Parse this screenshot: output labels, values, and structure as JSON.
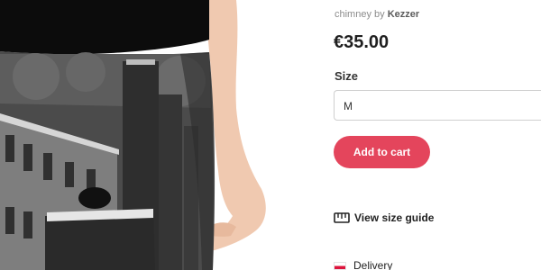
{
  "product": {
    "byline_prefix": "chimney by",
    "artist": "Kezzer",
    "price": "€35.00",
    "image_icon": "product-photo"
  },
  "size": {
    "label": "Size",
    "selected": "M"
  },
  "actions": {
    "add_to_cart": "Add to cart"
  },
  "links": {
    "size_guide": "View size guide",
    "size_guide_icon": "ruler-icon",
    "delivery": "Delivery",
    "delivery_icon": "flag-icon"
  },
  "colors": {
    "accent": "#e4455c",
    "text_dark": "#1f1f1f",
    "muted": "#8c8c8c"
  }
}
